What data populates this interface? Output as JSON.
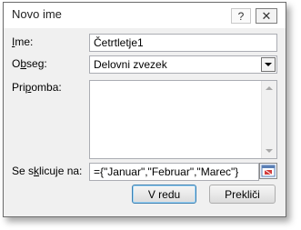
{
  "dialog": {
    "title": "Novo ime",
    "help_glyph": "?",
    "close_glyph": "✕"
  },
  "fields": {
    "name_label": "Ime:",
    "name_label_key": "I",
    "name_label_rest": "me:",
    "name_value": "Četrtletje1",
    "scope_label_pre": "O",
    "scope_label_key": "b",
    "scope_label_rest": "seg:",
    "scope_value": "Delovni zvezek",
    "comment_label_pre": "Pri",
    "comment_label_key": "p",
    "comment_label_rest": "omba:",
    "comment_value": "",
    "refers_label_pre": "Se s",
    "refers_label_key": "k",
    "refers_label_rest": "licuje na:",
    "refers_value": "={\"Januar\",\"Februar\",\"Marec\"}"
  },
  "buttons": {
    "ok": "V redu",
    "cancel": "Prekliči"
  },
  "icons": {
    "help": "help-icon",
    "close": "close-icon",
    "dropdown": "chevron-down-icon",
    "collapse": "collapse-dialog-icon"
  },
  "colors": {
    "ok_border": "#3c7fb1",
    "dialog_bg": "#f0f0f0"
  }
}
